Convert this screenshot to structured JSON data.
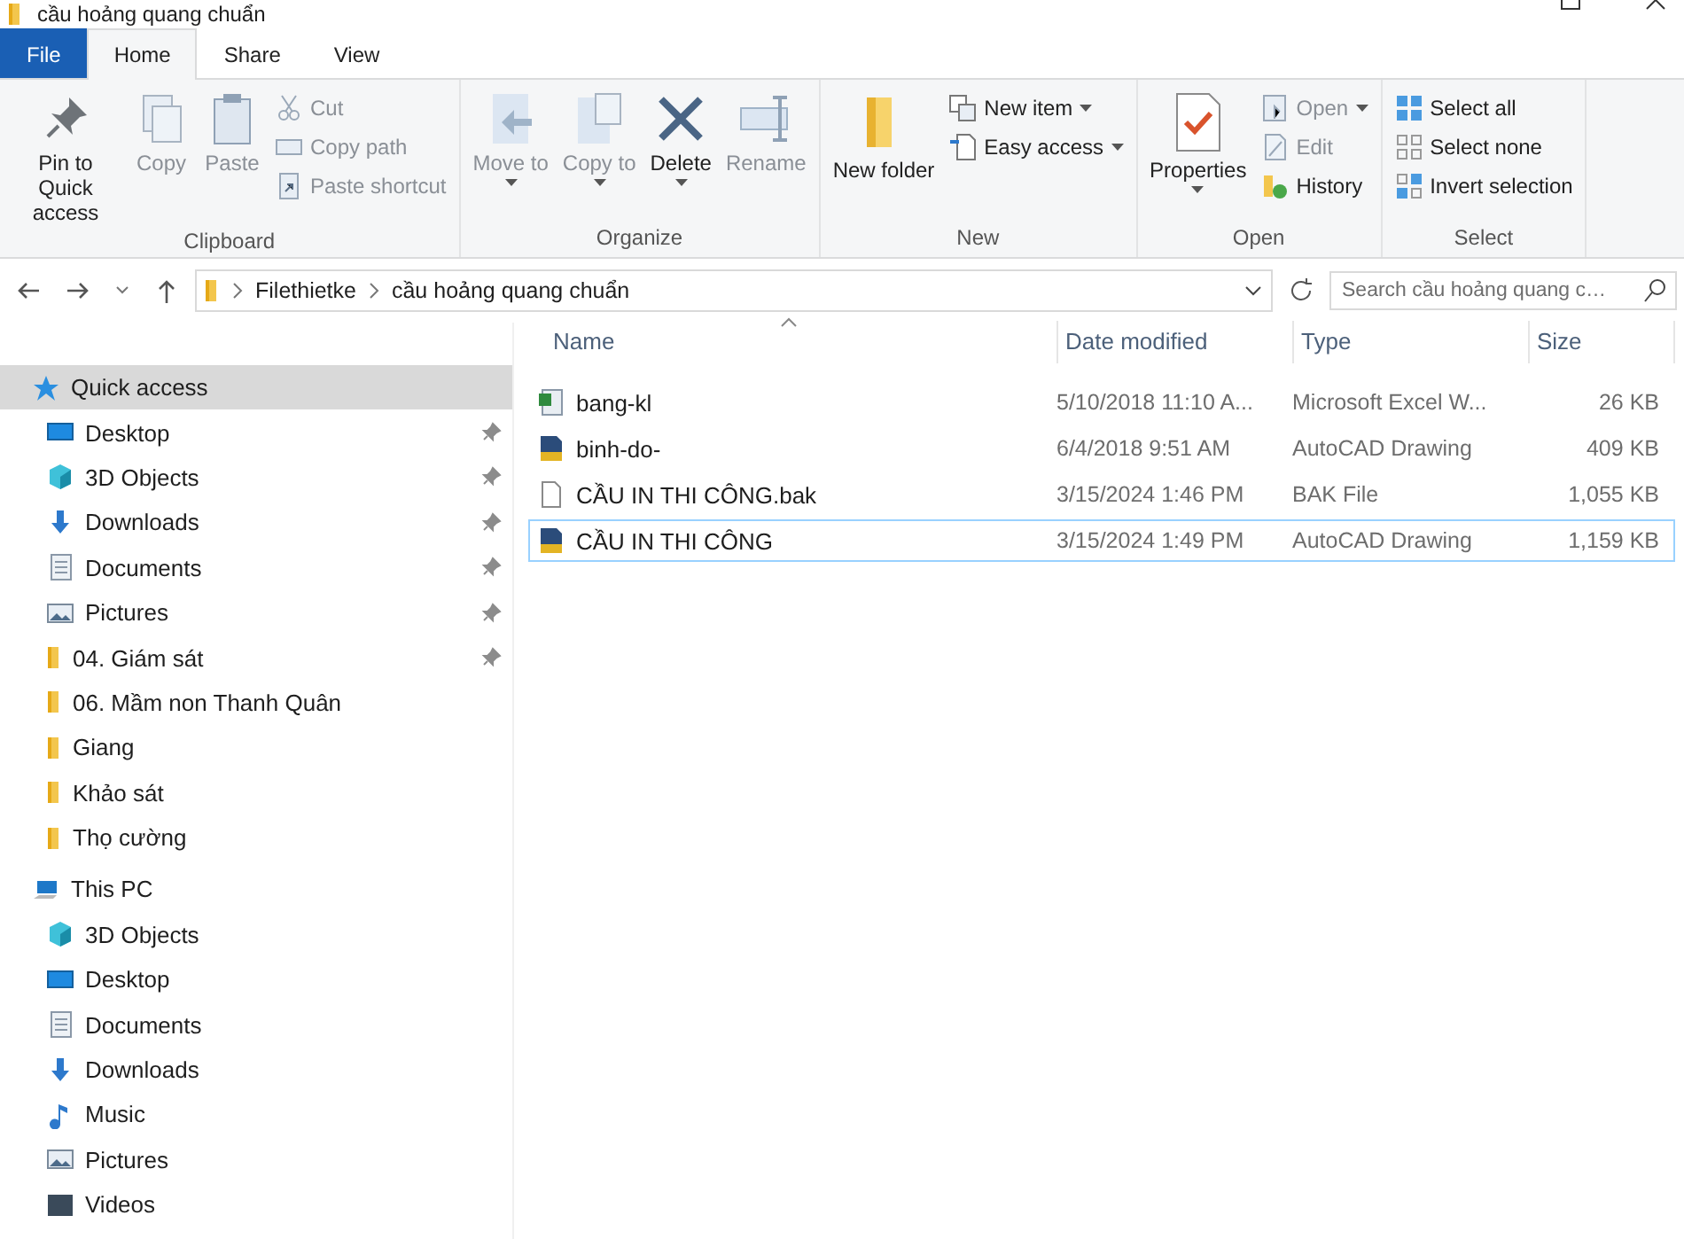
{
  "window": {
    "title": "cầu hoảng quang chuẩn"
  },
  "tabs": [
    {
      "label": "File",
      "kind": "file",
      "selected": false
    },
    {
      "label": "Home",
      "kind": "tab",
      "selected": true
    },
    {
      "label": "Share",
      "kind": "tab",
      "selected": false
    },
    {
      "label": "View",
      "kind": "tab",
      "selected": false
    }
  ],
  "ribbon": [
    {
      "name": "Clipboard",
      "buttons": [
        {
          "kind": "large",
          "label": "Pin to Quick access",
          "disabled": false
        },
        {
          "kind": "large",
          "label": "Copy",
          "disabled": true
        },
        {
          "kind": "large",
          "label": "Paste",
          "disabled": true
        },
        {
          "kind": "stack",
          "items": [
            {
              "label": "Cut",
              "disabled": true
            },
            {
              "label": "Copy path",
              "disabled": true
            },
            {
              "label": "Paste shortcut",
              "disabled": true
            }
          ]
        }
      ]
    },
    {
      "name": "Organize",
      "buttons": [
        {
          "kind": "large",
          "label": "Move to",
          "disabled": true,
          "dropdown": true
        },
        {
          "kind": "large",
          "label": "Copy to",
          "disabled": true,
          "dropdown": true
        },
        {
          "kind": "large",
          "label": "Delete",
          "disabled": false,
          "dropdown": true
        },
        {
          "kind": "large",
          "label": "Rename",
          "disabled": true
        }
      ]
    },
    {
      "name": "New",
      "buttons": [
        {
          "kind": "large",
          "label": "New folder",
          "disabled": false
        },
        {
          "kind": "stack",
          "items": [
            {
              "label": "New item",
              "disabled": false,
              "dropdown": true
            },
            {
              "label": "Easy access",
              "disabled": false,
              "dropdown": true
            }
          ]
        }
      ]
    },
    {
      "name": "Open",
      "buttons": [
        {
          "kind": "large",
          "label": "Properties",
          "disabled": false,
          "dropdown": true
        },
        {
          "kind": "stack",
          "items": [
            {
              "label": "Open",
              "disabled": true,
              "dropdown": true
            },
            {
              "label": "Edit",
              "disabled": true
            },
            {
              "label": "History",
              "disabled": false
            }
          ]
        }
      ]
    },
    {
      "name": "Select",
      "buttons": [
        {
          "kind": "stack",
          "items": [
            {
              "label": "Select all",
              "disabled": false
            },
            {
              "label": "Select none",
              "disabled": false
            },
            {
              "label": "Invert selection",
              "disabled": false
            }
          ]
        }
      ]
    }
  ],
  "address": {
    "path": [
      "Filethietke",
      "cầu hoảng quang chuẩn"
    ],
    "search_placeholder": "Search cầu hoảng quang c…"
  },
  "sidebar": {
    "items": [
      {
        "label": "Quick access",
        "kind": "star",
        "selected": true,
        "children": [
          {
            "label": "Desktop",
            "kind": "desktop",
            "pinned": true,
            "selected": false
          },
          {
            "label": "3D Objects",
            "kind": "cube",
            "pinned": true,
            "selected": false
          },
          {
            "label": "Downloads",
            "kind": "download",
            "pinned": true,
            "selected": false
          },
          {
            "label": "Documents",
            "kind": "document",
            "pinned": true,
            "selected": false
          },
          {
            "label": "Pictures",
            "kind": "picture",
            "pinned": true,
            "selected": false
          },
          {
            "label": "04. Giám sát",
            "kind": "folder",
            "pinned": true,
            "selected": false
          },
          {
            "label": "06. Mầm non Thanh Quân",
            "kind": "folder",
            "pinned": false,
            "selected": false
          },
          {
            "label": "Giang",
            "kind": "folder",
            "pinned": false,
            "selected": false
          },
          {
            "label": "Khảo sát",
            "kind": "folder",
            "pinned": false,
            "selected": false
          },
          {
            "label": "Thọ cường",
            "kind": "folder",
            "pinned": false,
            "selected": false
          }
        ]
      },
      {
        "label": "This PC",
        "kind": "pc",
        "selected": false,
        "children": [
          {
            "label": "3D Objects",
            "kind": "cube",
            "pinned": false,
            "selected": false
          },
          {
            "label": "Desktop",
            "kind": "desktop",
            "pinned": false,
            "selected": false
          },
          {
            "label": "Documents",
            "kind": "document",
            "pinned": false,
            "selected": false
          },
          {
            "label": "Downloads",
            "kind": "download",
            "pinned": false,
            "selected": false
          },
          {
            "label": "Music",
            "kind": "music",
            "pinned": false,
            "selected": false
          },
          {
            "label": "Pictures",
            "kind": "picture",
            "pinned": false,
            "selected": false
          },
          {
            "label": "Videos",
            "kind": "video",
            "pinned": false,
            "selected": false
          }
        ]
      }
    ]
  },
  "table": {
    "columns": [
      "Name",
      "Date modified",
      "Type",
      "Size"
    ],
    "rows": [
      {
        "kind": "excel",
        "name": "bang-kl",
        "date": "5/10/2018 11:10 A...",
        "type": "Microsoft Excel W...",
        "size": "26 KB",
        "selected": false
      },
      {
        "kind": "dwg",
        "name": "binh-do-",
        "date": "6/4/2018 9:51 AM",
        "type": "AutoCAD Drawing",
        "size": "409 KB",
        "selected": false
      },
      {
        "kind": "file",
        "name": "CẦU IN THI CÔNG.bak",
        "date": "3/15/2024 1:46 PM",
        "type": "BAK File",
        "size": "1,055 KB",
        "selected": false
      },
      {
        "kind": "dwg",
        "name": "CẦU IN THI CÔNG",
        "date": "3/15/2024 1:49 PM",
        "type": "AutoCAD Drawing",
        "size": "1,159 KB",
        "selected": true
      }
    ]
  }
}
